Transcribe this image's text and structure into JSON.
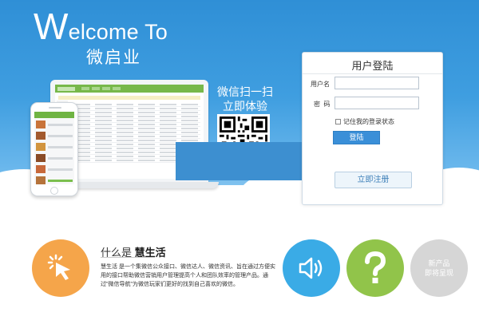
{
  "hero": {
    "welcome_initial": "W",
    "welcome_rest": "elcome To",
    "brand_name": "微启业"
  },
  "promo": {
    "qr_line1": "微信扫一扫",
    "qr_line2": "立即体验"
  },
  "login": {
    "title": "用户登陆",
    "username_label": "用户名",
    "username_value": "",
    "password_label": "密  码",
    "password_value": "",
    "remember_label": "记住我的登录状态",
    "login_button": "登陆",
    "register_button": "立即注册"
  },
  "about": {
    "title_prefix": "什么是",
    "title_brand": "慧生活",
    "description": "慧生活 是一个集微信公众接口、微信达人、微信资讯、旨在通过方便实用的接口帮助微信营销用户管理提高个人和团队效率的管理产品。通过\"微信导航\"为微信玩家们更好的找到自己喜欢的微信。"
  },
  "features": {
    "new_product_line1": "新产品",
    "new_product_line2": "即将呈现"
  },
  "colors": {
    "hero_blue": "#3f9ee0",
    "accent_orange": "#f5a54a",
    "accent_blue": "#3aabe6",
    "accent_green": "#91c44a",
    "disabled_grey": "#d6d6d6",
    "login_button": "#3a8fd8"
  }
}
